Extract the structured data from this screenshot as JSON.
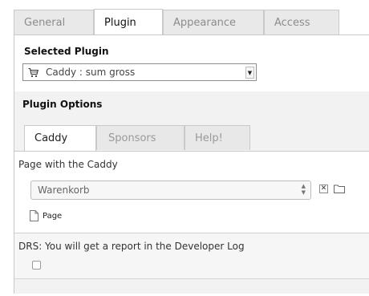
{
  "outer_tabs": [
    {
      "label": "General",
      "active": false
    },
    {
      "label": "Plugin",
      "active": true
    },
    {
      "label": "Appearance",
      "active": false
    },
    {
      "label": "Access",
      "active": false
    }
  ],
  "selected_plugin": {
    "heading": "Selected Plugin",
    "value": "Caddy : sum gross",
    "icon": "shopping-cart-icon"
  },
  "plugin_options": {
    "heading": "Plugin Options",
    "tabs": [
      {
        "label": "Caddy",
        "active": true
      },
      {
        "label": "Sponsors",
        "active": false
      },
      {
        "label": "Help!",
        "active": false
      }
    ],
    "page_with_caddy": {
      "label": "Page with the Caddy",
      "value": "Warenkorb",
      "page_item_label": "Page"
    },
    "drs": {
      "label": "DRS: You will get a report in the Developer Log",
      "checked": false
    }
  }
}
